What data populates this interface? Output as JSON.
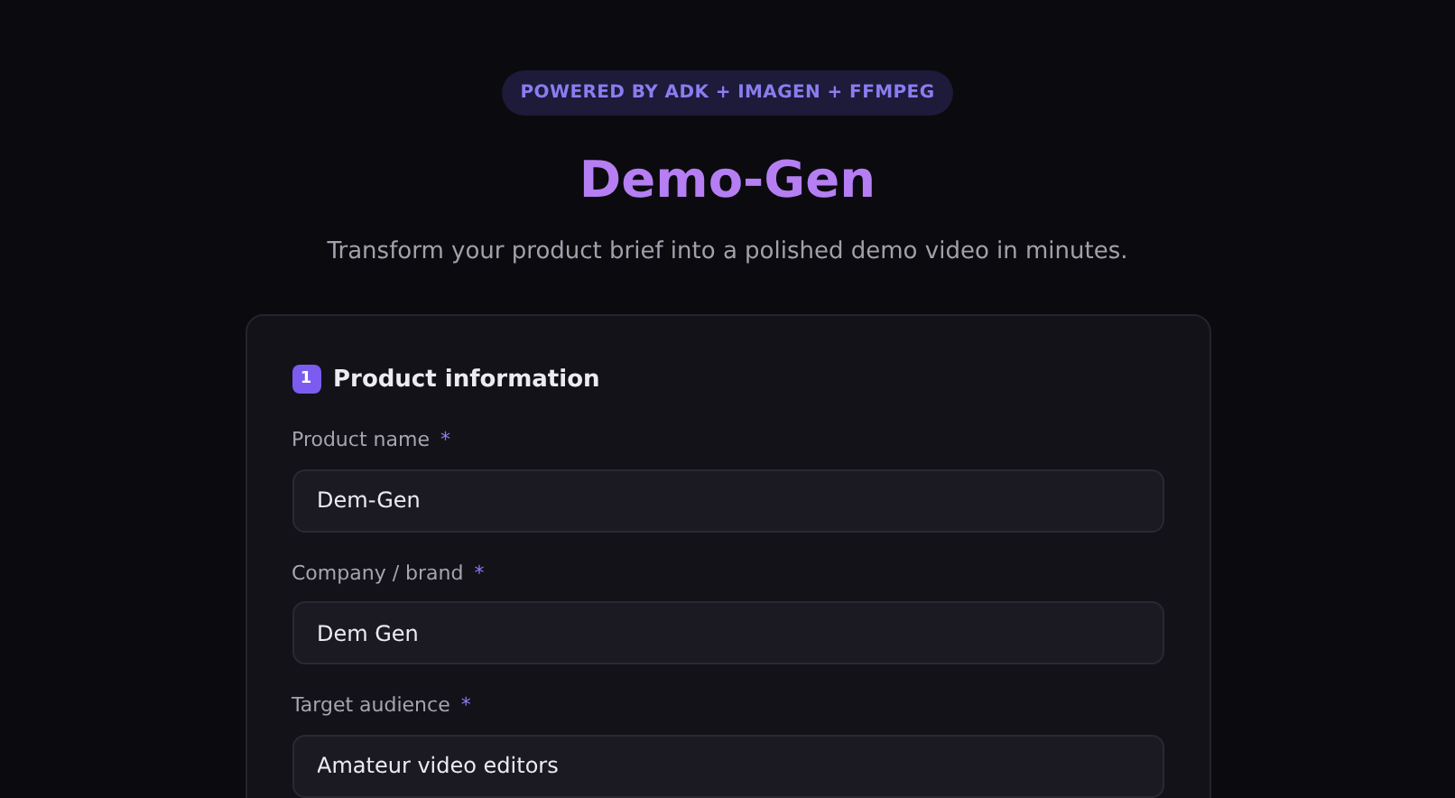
{
  "badge": "POWERED BY ADK + IMAGEN + FFMPEG",
  "title": "Demo-Gen",
  "subtitle": "Transform your product brief into a polished demo video in minutes.",
  "section": {
    "step": "1",
    "title": "Product information",
    "fields": [
      {
        "label": "Product name",
        "required_mark": "*",
        "value": "Dem-Gen"
      },
      {
        "label": "Company / brand",
        "required_mark": "*",
        "value": "Dem Gen"
      },
      {
        "label": "Target audience",
        "required_mark": "*",
        "value": "Amateur video editors"
      }
    ]
  }
}
